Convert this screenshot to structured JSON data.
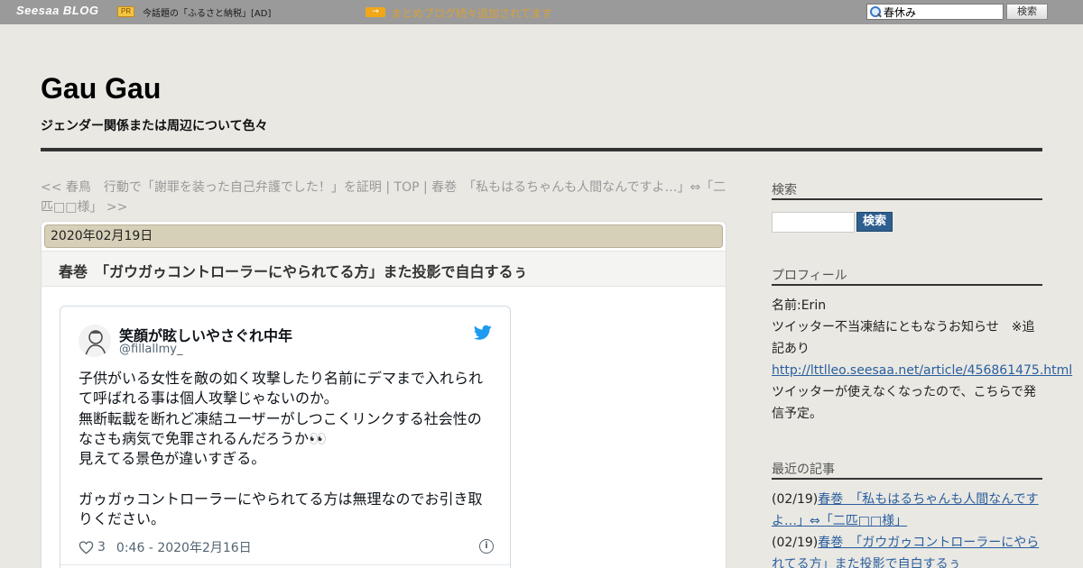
{
  "topbar": {
    "logo": "Seesaa BLOG",
    "pr_badge": "PR",
    "pr_text": "今話題の「ふるさと納税」[AD]",
    "arrow_label": "→",
    "news_text": "まとめブログ続々追加されてます",
    "search_value": "春休み",
    "search_button": "検索"
  },
  "header": {
    "title": "Gau Gau",
    "description": "ジェンダー関係または周辺について色々"
  },
  "nav": {
    "text": "<< 春鳥　行動で「謝罪を装った自己弁護でした！」を証明 | TOP | 春巻　「私もはるちゃんも人間なんですよ…」⇔「二匹□□様」 >>"
  },
  "article": {
    "date": "2020年02月19日",
    "title": "春巻　「ガウガゥコントローラーにやられてる方」また投影で自白するぅ"
  },
  "tweet": {
    "name": "笑顔が眩しいやさぐれ中年",
    "handle": "@fillallmy_",
    "text": "子供がいる女性を敵の如く攻撃したり名前にデマまで入れられて呼ばれる事は個人攻撃じゃないのか。\n無断転載を断れど凍結ユーザーがしつこくリンクする社会性のなさも病気で免罪されるんだろうか👀\n見えてる景色が違いすぎる。\n\nガゥガゥコントローラーにやられてる方は無理なのでお引き取りください。",
    "likes": "3",
    "timestamp": "0:46 - 2020年2月16日",
    "info": "i"
  },
  "sidebar": {
    "search": {
      "heading": "検索",
      "button": "検索"
    },
    "profile": {
      "heading": "プロフィール",
      "name_line": "名前:Erin",
      "notice": "ツイッター不当凍結にともなうお知らせ　※追記あり",
      "link": "http://lttlleo.seesaa.net/article/456861475.html",
      "note": "ツイッターが使えなくなったので、こちらで発信予定。"
    },
    "recent": {
      "heading": "最近の記事",
      "items": [
        {
          "date": "(02/19)",
          "title": "春巻　「私もはるちゃんも人間なんですよ…」⇔「二匹□□様」"
        },
        {
          "date": "(02/19)",
          "title": "春巻　「ガウガゥコントローラーにやられてる方」また投影で自白するぅ"
        }
      ]
    }
  }
}
